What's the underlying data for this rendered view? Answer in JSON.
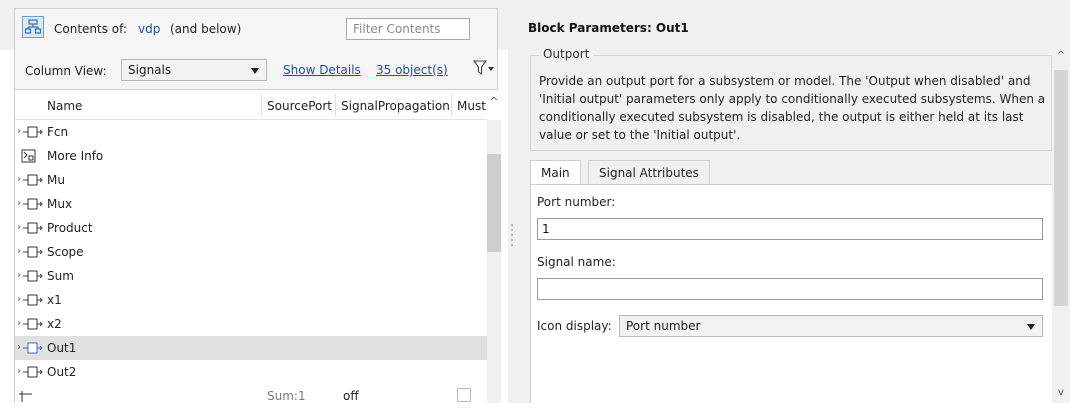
{
  "contents": {
    "label": "Contents of:",
    "model": "vdp",
    "scope": "(and below)",
    "filter_placeholder": "Filter Contents"
  },
  "column_view": {
    "label": "Column View:",
    "selected": "Signals",
    "show_details": "Show Details",
    "object_count": "35 object(s)"
  },
  "table": {
    "headers": [
      "Name",
      "SourcePort",
      "SignalPropagation",
      "Must"
    ],
    "rows": [
      {
        "name": "Fcn",
        "expandable": true,
        "icon": "block-icon"
      },
      {
        "name": "More Info",
        "expandable": false,
        "icon": "info-block-icon"
      },
      {
        "name": "Mu",
        "expandable": true,
        "icon": "block-icon"
      },
      {
        "name": "Mux",
        "expandable": true,
        "icon": "block-icon"
      },
      {
        "name": "Product",
        "expandable": true,
        "icon": "block-icon"
      },
      {
        "name": "Scope",
        "expandable": true,
        "icon": "block-icon"
      },
      {
        "name": "Sum",
        "expandable": true,
        "icon": "block-icon"
      },
      {
        "name": "x1",
        "expandable": true,
        "icon": "block-icon"
      },
      {
        "name": "x2",
        "expandable": true,
        "icon": "block-icon"
      },
      {
        "name": "Out1",
        "expandable": true,
        "icon": "block-icon",
        "selected": true
      },
      {
        "name": "Out2",
        "expandable": true,
        "icon": "block-icon"
      },
      {
        "name": "",
        "expandable": false,
        "icon": "signal-line-icon",
        "source_port": "Sum:1",
        "signal_propagation": "off",
        "must": false
      }
    ]
  },
  "block_parameters": {
    "title": "Block Parameters: Out1",
    "group_label": "Outport",
    "description": "Provide an output port for a subsystem or model.  The 'Output when disabled' and 'Initial output' parameters only apply to conditionally executed subsystems. When a conditionally executed subsystem is disabled, the output is either held at its last value or set to the 'Initial output'.",
    "tabs": [
      "Main",
      "Signal Attributes"
    ],
    "active_tab": "Main",
    "port_number_label": "Port number:",
    "port_number_value": "1",
    "signal_name_label": "Signal name:",
    "signal_name_value": "",
    "icon_display_label": "Icon display:",
    "icon_display_value": "Port number"
  },
  "colors": {
    "link": "#1a4fa8",
    "selected_row": "#e0e0e0",
    "panel_bg": "#f0f0f0"
  }
}
